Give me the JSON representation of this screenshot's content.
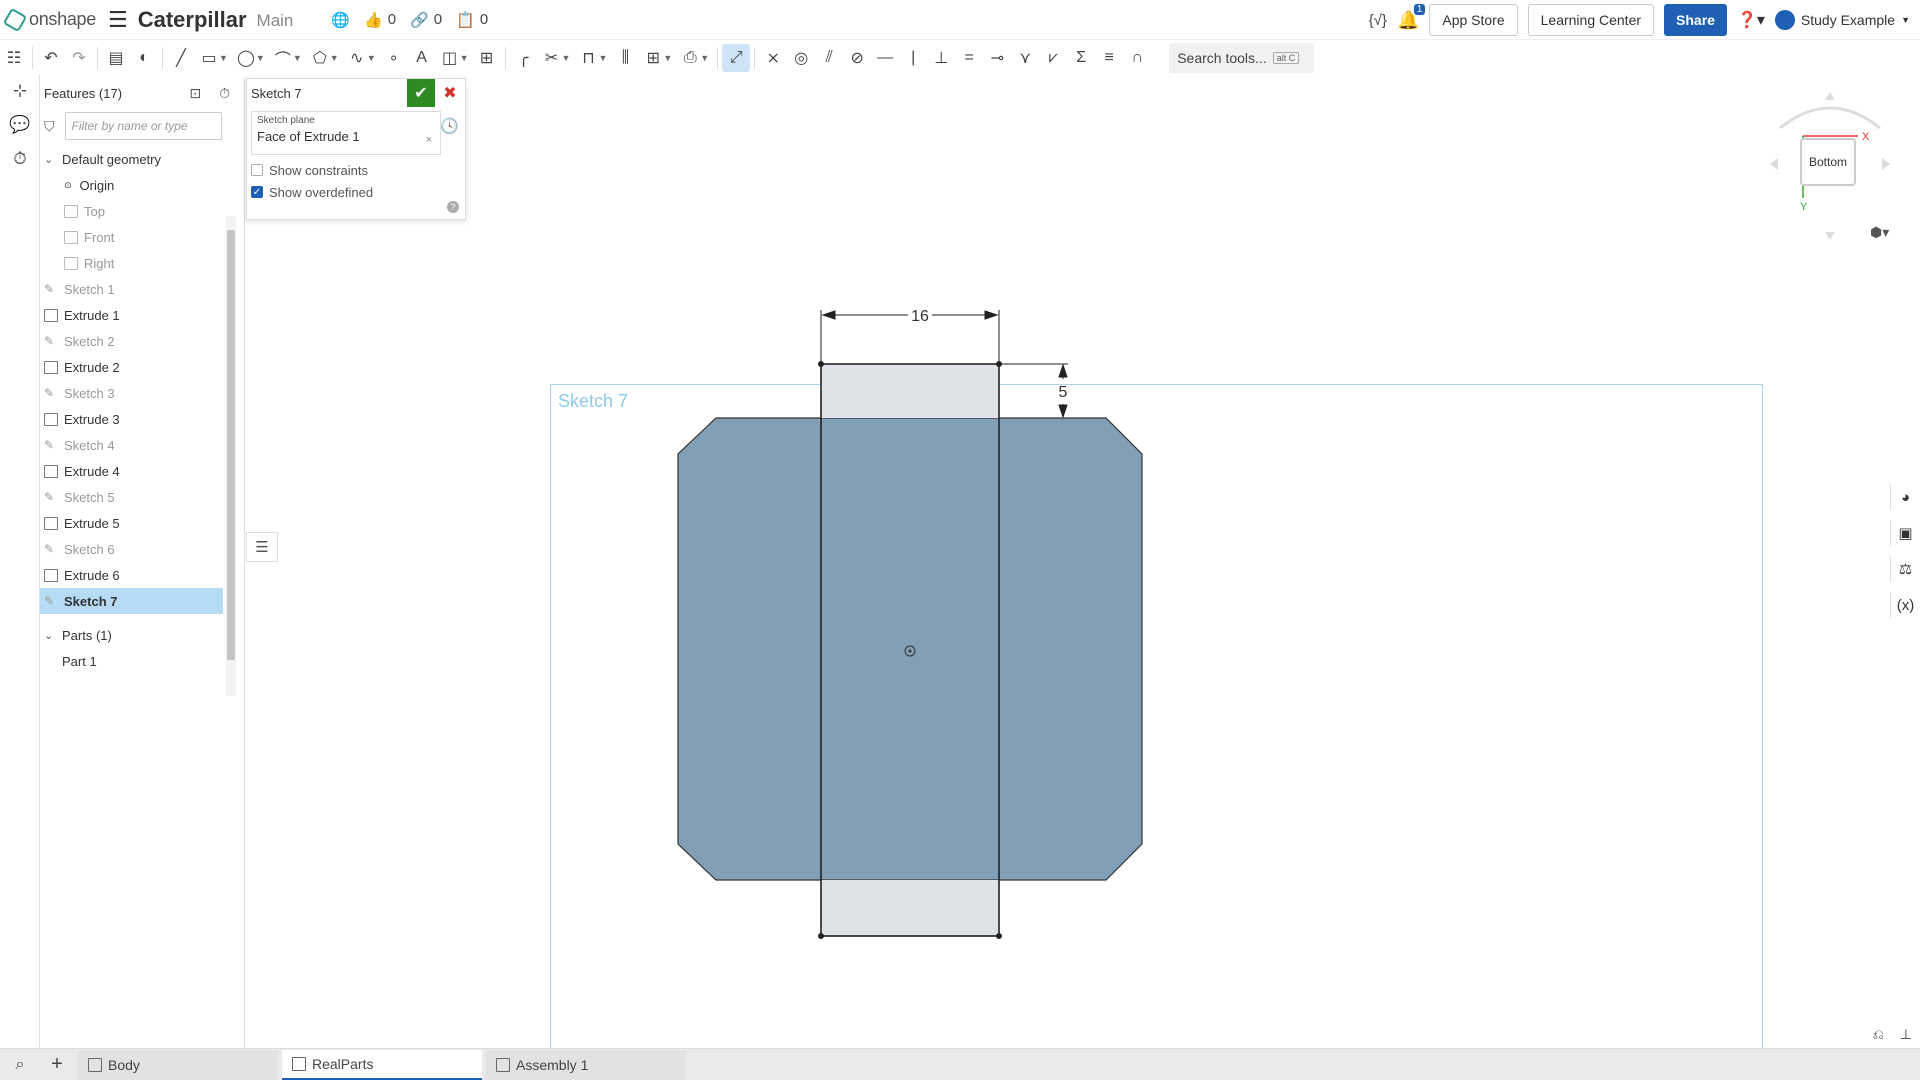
{
  "app": {
    "logo_text": "onshape",
    "doc_title": "Caterpillar",
    "branch": "Main",
    "likes": "0",
    "links": "0",
    "copies": "0",
    "notification_count": "1",
    "app_store": "App Store",
    "learning_center": "Learning Center",
    "share": "Share",
    "user_name": "Study Example"
  },
  "toolbar": {
    "search_placeholder": "Search tools...",
    "search_shortcut": "alt C"
  },
  "features": {
    "header": "Features (17)",
    "filter_placeholder": "Filter by name or type",
    "default_geometry": "Default geometry",
    "origin": "Origin",
    "planes": [
      "Top",
      "Front",
      "Right"
    ],
    "items": [
      {
        "label": "Sketch 1",
        "kind": "sketch"
      },
      {
        "label": "Extrude 1",
        "kind": "extrude"
      },
      {
        "label": "Sketch 2",
        "kind": "sketch"
      },
      {
        "label": "Extrude 2",
        "kind": "extrude"
      },
      {
        "label": "Sketch 3",
        "kind": "sketch"
      },
      {
        "label": "Extrude 3",
        "kind": "extrude"
      },
      {
        "label": "Sketch 4",
        "kind": "sketch"
      },
      {
        "label": "Extrude 4",
        "kind": "extrude"
      },
      {
        "label": "Sketch 5",
        "kind": "sketch"
      },
      {
        "label": "Extrude 5",
        "kind": "extrude"
      },
      {
        "label": "Sketch 6",
        "kind": "sketch"
      },
      {
        "label": "Extrude 6",
        "kind": "extrude"
      },
      {
        "label": "Sketch 7",
        "kind": "sketch",
        "selected": true
      }
    ],
    "parts_header": "Parts (1)",
    "part": "Part 1"
  },
  "sketch_dialog": {
    "title": "Sketch 7",
    "plane_label": "Sketch plane",
    "plane_value": "Face of Extrude 1",
    "show_constraints": "Show constraints",
    "show_constraints_checked": false,
    "show_overdefined": "Show overdefined",
    "show_overdefined_checked": true
  },
  "viewport": {
    "sketch_label": "Sketch 7",
    "dim_width": "16",
    "dim_offset": "5",
    "view_name": "Bottom",
    "axis_x": "X",
    "axis_y": "Y",
    "part_color": "#819fb6",
    "rect_fill": "#dfe3e7"
  },
  "tabs": [
    {
      "label": "Body",
      "active": false
    },
    {
      "label": "RealParts",
      "active": true
    },
    {
      "label": "Assembly 1",
      "active": false
    }
  ]
}
